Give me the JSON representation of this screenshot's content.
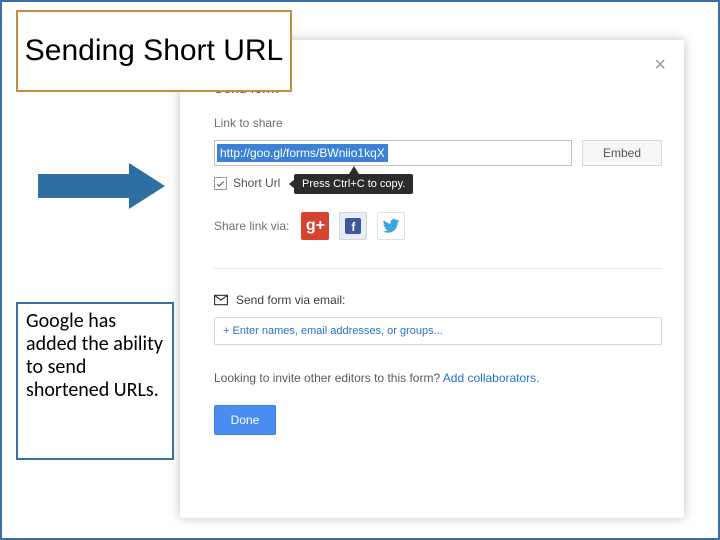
{
  "slide": {
    "title": "Sending Short URL",
    "caption": "Google has added the ability to send shortened URLs."
  },
  "dialog": {
    "title": "Send form",
    "close_glyph": "×",
    "link_section_label": "Link to share",
    "url": "http://goo.gl/forms/BWniio1kqX",
    "embed_label": "Embed",
    "short_url_label": "Short Url",
    "tooltip": "Press Ctrl+C to copy.",
    "share_via_label": "Share link via:",
    "gplus_glyph": "g+",
    "fb_glyph": "f",
    "email_section_label": "Send form via email:",
    "recipients_placeholder": "+ Enter names, email addresses, or groups...",
    "collab_text": "Looking to invite other editors to this form? ",
    "collab_link": "Add collaborators.",
    "done_label": "Done"
  }
}
